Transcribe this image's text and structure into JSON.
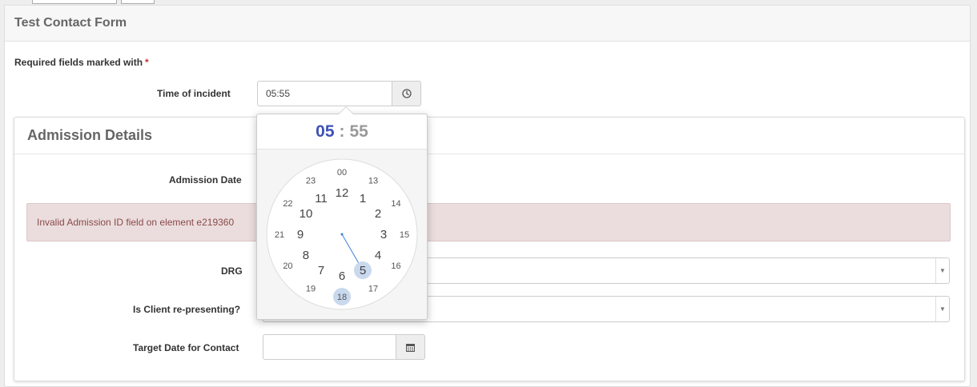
{
  "form": {
    "title": "Test Contact Form",
    "required_note": "Required fields marked with",
    "required_star": "*"
  },
  "time_field": {
    "label": "Time of incident",
    "value": "05:55",
    "icon": "clock-icon"
  },
  "admission": {
    "title": "Admission Details",
    "date_label": "Admission Date",
    "alert_text": "Invalid Admission ID field on element e219360",
    "drg_label": "DRG",
    "drg_value": "",
    "representing_label": "Is Client re-presenting?",
    "representing_value": "",
    "target_date_label": "Target Date for Contact",
    "target_date_value": "",
    "target_date_icon": "calendar-icon"
  },
  "clockpicker": {
    "hours": "05",
    "separator": ":",
    "minutes": "55",
    "selected_hour": 5,
    "outer_numbers": [
      "12",
      "1",
      "2",
      "3",
      "4",
      "5",
      "6",
      "7",
      "8",
      "9",
      "10",
      "11"
    ],
    "inner_numbers": [
      "00",
      "13",
      "14",
      "15",
      "16",
      "17",
      "18",
      "19",
      "20",
      "21",
      "22",
      "23"
    ],
    "highlight_color": "#c9d9ee",
    "hand_color": "#3f7fd8"
  }
}
